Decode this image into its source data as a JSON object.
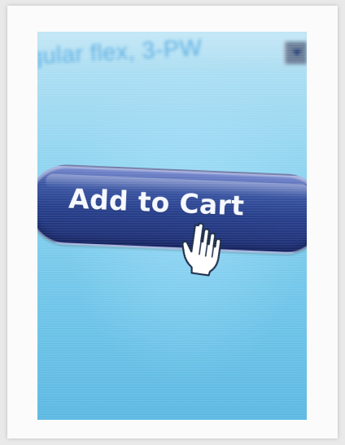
{
  "image": {
    "dropdown_text": "gular flex, 3-PW",
    "button_label": "Add to Cart",
    "dropdown_arrow_icon": "chevron-down-icon",
    "cursor_icon": "hand-cursor-icon"
  },
  "colors": {
    "page_background": "#e9e9e9",
    "frame_background": "#fbfbfb",
    "screen_blue": "#8fd4f0",
    "button_blue": "#273f8b",
    "button_text": "#f5f8ff",
    "dropdown_text": "#4da5df"
  }
}
